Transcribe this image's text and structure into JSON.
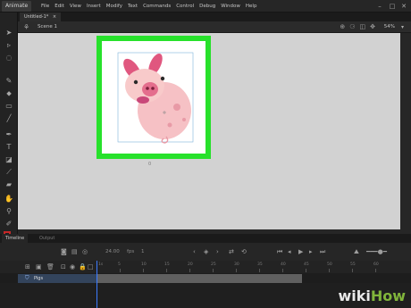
{
  "menubar": {
    "app_name": "Animate",
    "items": [
      "File",
      "Edit",
      "View",
      "Insert",
      "Modify",
      "Text",
      "Commands",
      "Control",
      "Debug",
      "Window",
      "Help"
    ],
    "minimize": "–",
    "maximize": "□",
    "close": "✕"
  },
  "document": {
    "tab_label": "Untitled-1*",
    "tab_close": "×"
  },
  "scene": {
    "label": "Scene 1",
    "zoom": "54%"
  },
  "stage": {
    "artboard_label": "0",
    "highlight_color": "#27e12b"
  },
  "panels": {
    "timeline_tab": "Timeline",
    "output_tab": "Output"
  },
  "timeline": {
    "fps": "24.00",
    "frame": "1",
    "ruler_marks": [
      "1s",
      "5",
      "10",
      "15",
      "20",
      "25",
      "30",
      "35",
      "40",
      "45",
      "50",
      "55",
      "60"
    ]
  },
  "layer": {
    "name": "Pigs"
  },
  "icons": {
    "select": "selection-tool-icon",
    "pen": "pen-tool-icon",
    "text": "text-tool-icon",
    "play": "play-icon"
  },
  "colors": {
    "stroke": "#c62828",
    "fill": "#c62828",
    "accent": "#27e12b",
    "layer_highlight": "#33445c"
  },
  "watermark": {
    "prefix": "wiki",
    "suffix": "How"
  }
}
